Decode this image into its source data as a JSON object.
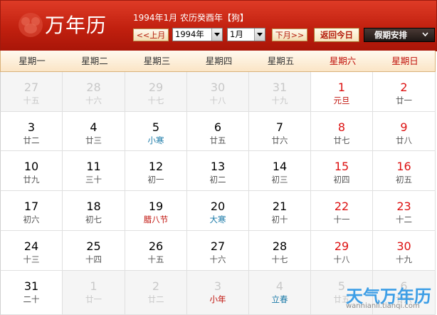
{
  "header": {
    "app_title": "万年历",
    "date_info": "1994年1月 农历癸酉年【狗】",
    "prev_label": "<<上月",
    "year_value": "1994年",
    "month_value": "1月",
    "next_label": "下月>>",
    "today_label": "返回今日",
    "holiday_label": "假期安排",
    "accent_color": "#c1200f"
  },
  "weekdays": [
    "星期一",
    "星期二",
    "星期三",
    "星期四",
    "星期五",
    "星期六",
    "星期日"
  ],
  "weeks": [
    [
      {
        "day": "27",
        "lunar": "十五",
        "other": true
      },
      {
        "day": "28",
        "lunar": "十六",
        "other": true
      },
      {
        "day": "29",
        "lunar": "十七",
        "other": true
      },
      {
        "day": "30",
        "lunar": "十八",
        "other": true
      },
      {
        "day": "31",
        "lunar": "十九",
        "other": true
      },
      {
        "day": "1",
        "lunar": "元旦",
        "kind": "fest-red"
      },
      {
        "day": "2",
        "lunar": "廿一"
      }
    ],
    [
      {
        "day": "3",
        "lunar": "廿二"
      },
      {
        "day": "4",
        "lunar": "廿三"
      },
      {
        "day": "5",
        "lunar": "小寒",
        "kind": "term"
      },
      {
        "day": "6",
        "lunar": "廿五"
      },
      {
        "day": "7",
        "lunar": "廿六"
      },
      {
        "day": "8",
        "lunar": "廿七"
      },
      {
        "day": "9",
        "lunar": "廿八"
      }
    ],
    [
      {
        "day": "10",
        "lunar": "廿九"
      },
      {
        "day": "11",
        "lunar": "三十"
      },
      {
        "day": "12",
        "lunar": "初一"
      },
      {
        "day": "13",
        "lunar": "初二"
      },
      {
        "day": "14",
        "lunar": "初三"
      },
      {
        "day": "15",
        "lunar": "初四"
      },
      {
        "day": "16",
        "lunar": "初五"
      }
    ],
    [
      {
        "day": "17",
        "lunar": "初六"
      },
      {
        "day": "18",
        "lunar": "初七"
      },
      {
        "day": "19",
        "lunar": "腊八节",
        "kind": "fest-red"
      },
      {
        "day": "20",
        "lunar": "大寒",
        "kind": "term"
      },
      {
        "day": "21",
        "lunar": "初十"
      },
      {
        "day": "22",
        "lunar": "十一"
      },
      {
        "day": "23",
        "lunar": "十二"
      }
    ],
    [
      {
        "day": "24",
        "lunar": "十三"
      },
      {
        "day": "25",
        "lunar": "十四"
      },
      {
        "day": "26",
        "lunar": "十五"
      },
      {
        "day": "27",
        "lunar": "十六"
      },
      {
        "day": "28",
        "lunar": "十七"
      },
      {
        "day": "29",
        "lunar": "十八"
      },
      {
        "day": "30",
        "lunar": "十九"
      }
    ],
    [
      {
        "day": "31",
        "lunar": "二十"
      },
      {
        "day": "1",
        "lunar": "廿一",
        "other": true
      },
      {
        "day": "2",
        "lunar": "廿二",
        "other": true
      },
      {
        "day": "3",
        "lunar": "小年",
        "other": true,
        "kind": "fest-red"
      },
      {
        "day": "4",
        "lunar": "立春",
        "other": true,
        "kind": "term"
      },
      {
        "day": "5",
        "lunar": "廿五",
        "other": true
      },
      {
        "day": "6",
        "lunar": "廿六",
        "other": true
      }
    ]
  ],
  "watermark": {
    "title": "天气万年历",
    "subtitle": "wannianli.tianqi.com"
  }
}
